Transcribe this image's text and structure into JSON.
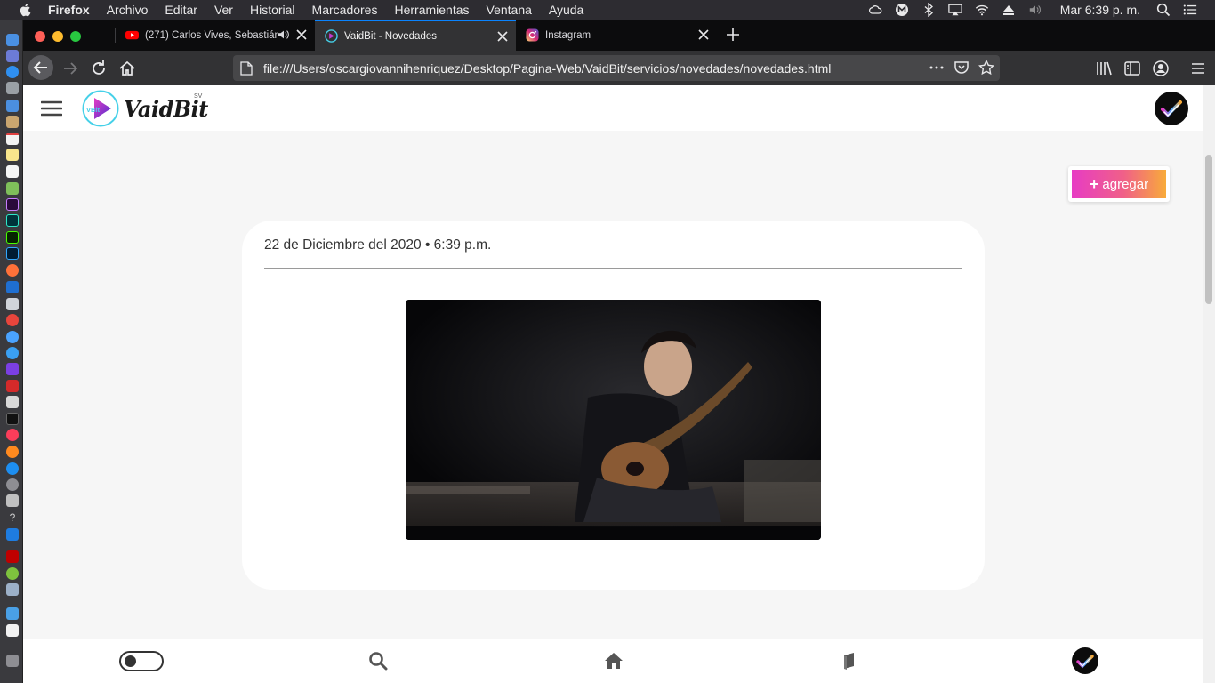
{
  "menubar": {
    "items": [
      "Firefox",
      "Archivo",
      "Editar",
      "Ver",
      "Historial",
      "Marcadores",
      "Herramientas",
      "Ventana",
      "Ayuda"
    ],
    "clock": "Mar 6:39 p. m."
  },
  "tabs": [
    {
      "title": "(271) Carlos Vives, Sebastián",
      "favicon": "youtube-icon",
      "active": false
    },
    {
      "title": "VaidBit - Novedades",
      "favicon": "vaidbit-icon",
      "active": true
    },
    {
      "title": "Instagram",
      "favicon": "instagram-icon",
      "active": false
    }
  ],
  "url": "file:///Users/oscargiovannihenriquez/Desktop/Pagina-Web/VaidBit/servicios/novedades/novedades.html",
  "site": {
    "logo_text": "VaidBit",
    "logo_sup": "SV",
    "logo_badge": "VBit"
  },
  "agregar": {
    "label": "agregar",
    "plus": "+"
  },
  "post": {
    "date": "22 de Diciembre del 2020 • 6:39 p.m.",
    "media": "video-thumbnail"
  },
  "colors": {
    "accent_gradient_start": "#e73cc4",
    "accent_gradient_end": "#f8ab3a",
    "firefox_tab_highlight": "#0a84ff"
  }
}
